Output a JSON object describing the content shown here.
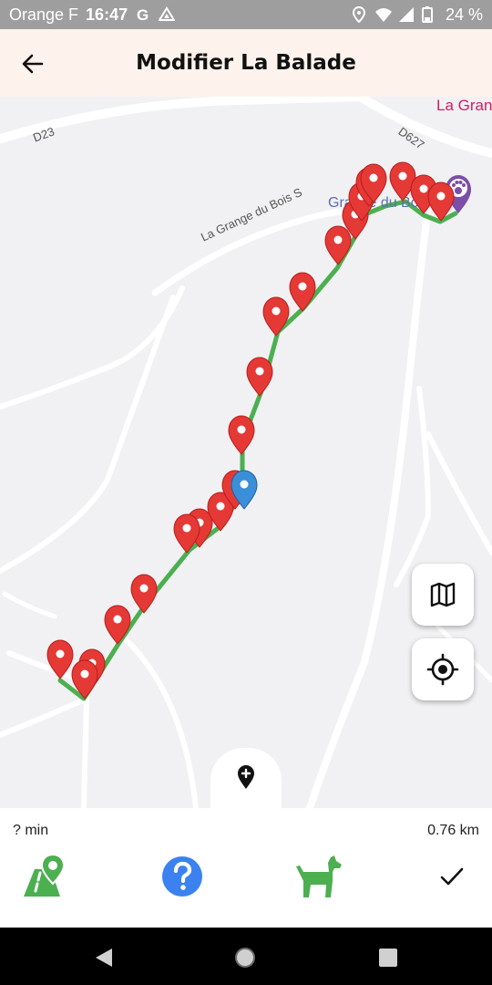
{
  "status_bar": {
    "carrier": "Orange F",
    "time": "16:47",
    "battery": "24 %",
    "left_icons": [
      "google-icon",
      "drive-icon"
    ],
    "right_icons": [
      "location-icon",
      "wifi-icon",
      "signal-icon",
      "battery-icon"
    ]
  },
  "header": {
    "title": "Modifier La Balade",
    "back_icon": "arrow-left-icon"
  },
  "map": {
    "road_labels": {
      "d23": "D23",
      "d627": "D627",
      "grange_road": "La Grange du Bois S"
    },
    "poi_label": "Grange du Bois",
    "town_label": "La Gran",
    "route_color": "#4caf50",
    "marker_color": "#e53935",
    "current_marker_color": "#3b8fd9",
    "poi_marker_color": "#7b4fa8",
    "buttons": {
      "map_type_icon": "map-icon",
      "locate_icon": "crosshair-icon",
      "add_marker_icon": "add-location-icon"
    }
  },
  "summary": {
    "duration": "? min",
    "distance": "0.76 km"
  },
  "actions": {
    "route_icon": "route-icon",
    "help_icon": "help-icon",
    "dog_icon": "dog-icon",
    "confirm_icon": "check-icon",
    "accent_color": "#4caf50",
    "help_color": "#3b82f0"
  },
  "nav_bar": {
    "back_icon": "nav-back-icon",
    "home_icon": "nav-home-icon",
    "recents_icon": "nav-recents-icon"
  }
}
